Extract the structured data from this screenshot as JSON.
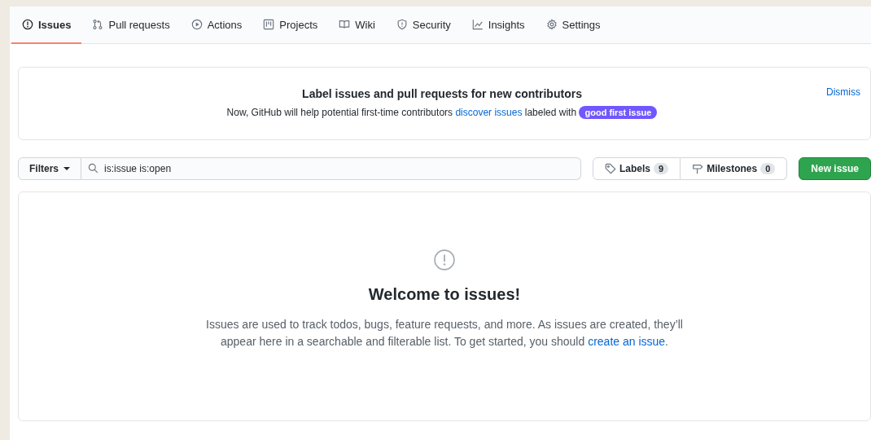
{
  "tabs": [
    {
      "label": "Issues",
      "kind": "issue",
      "selected": true
    },
    {
      "label": "Pull requests",
      "kind": "pr",
      "selected": false
    },
    {
      "label": "Actions",
      "kind": "play",
      "selected": false
    },
    {
      "label": "Projects",
      "kind": "project",
      "selected": false
    },
    {
      "label": "Wiki",
      "kind": "book",
      "selected": false
    },
    {
      "label": "Security",
      "kind": "shield",
      "selected": false
    },
    {
      "label": "Insights",
      "kind": "graph",
      "selected": false
    },
    {
      "label": "Settings",
      "kind": "gear",
      "selected": false
    }
  ],
  "banner": {
    "title": "Label issues and pull requests for new contributors",
    "text_before": "Now, GitHub will help potential first-time contributors",
    "link": "discover issues",
    "text_after": "labeled with",
    "label": "good first issue",
    "dismiss": "Dismiss"
  },
  "toolbar": {
    "filters": "Filters",
    "search_value": "is:issue is:open",
    "labels": "Labels",
    "labels_count": "9",
    "milestones": "Milestones",
    "milestones_count": "0",
    "new_issue": "New issue"
  },
  "blankslate": {
    "title": "Welcome to issues!",
    "text_before": "Issues are used to track todos, bugs, feature requests, and more. As issues are created, they’ll appear here in a searchable and filterable list. To get started, you should",
    "link": "create an issue",
    "text_after": "."
  }
}
